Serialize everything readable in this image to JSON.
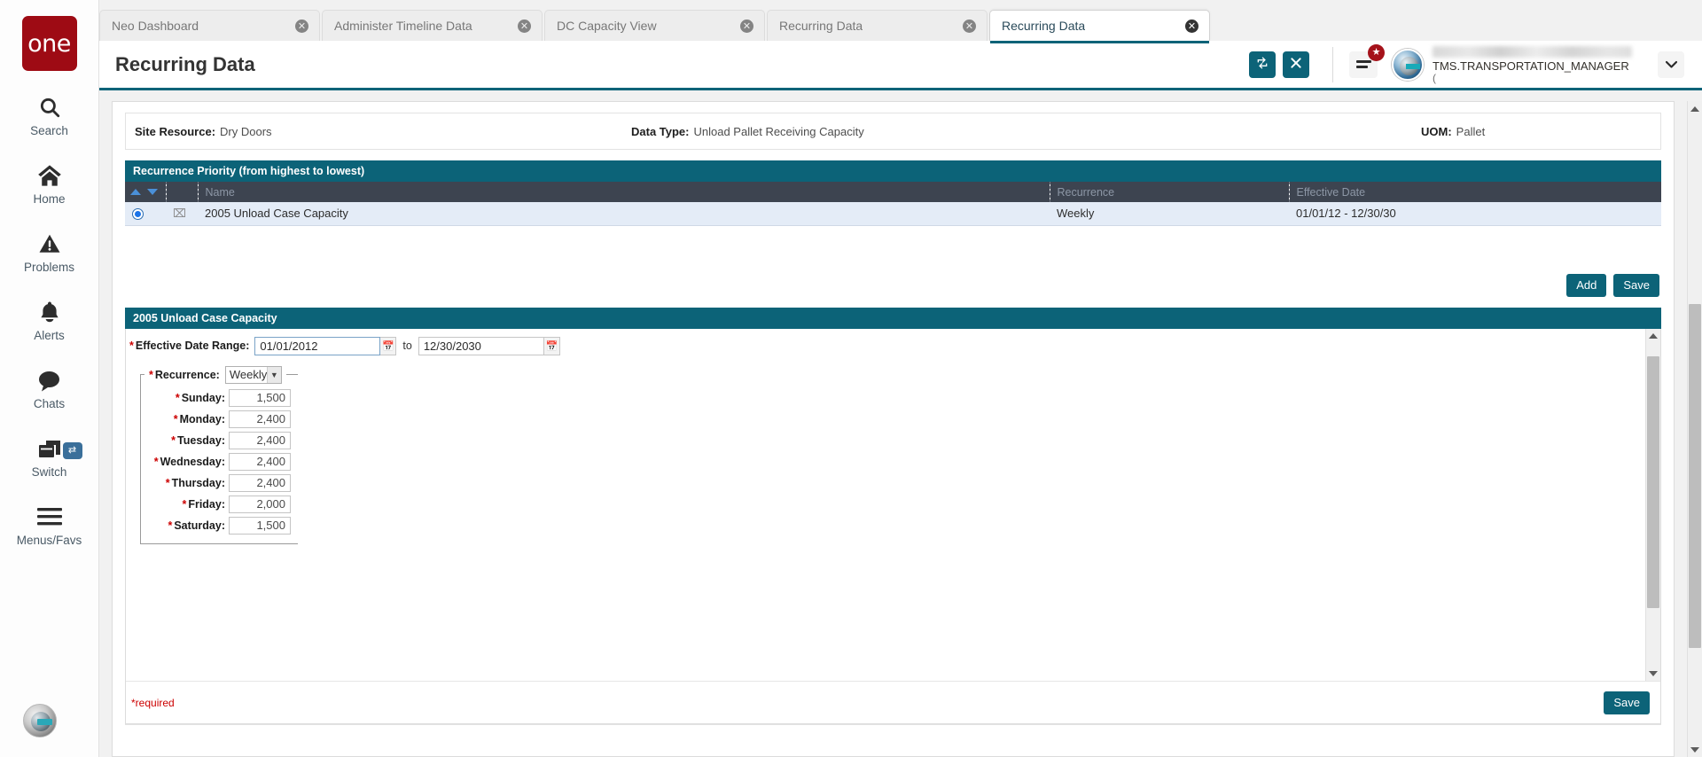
{
  "app": {
    "logo_text": "one"
  },
  "sidebar": {
    "items": [
      {
        "label": "Search",
        "icon": "search-icon"
      },
      {
        "label": "Home",
        "icon": "home-icon"
      },
      {
        "label": "Problems",
        "icon": "warning-triangle-icon"
      },
      {
        "label": "Alerts",
        "icon": "bell-icon"
      },
      {
        "label": "Chats",
        "icon": "chat-bubble-icon"
      },
      {
        "label": "Switch",
        "icon": "windows-stack-icon",
        "badge": "⇄"
      },
      {
        "label": "Menus/Favs",
        "icon": "hamburger-icon"
      }
    ]
  },
  "tabs": [
    {
      "label": "Neo Dashboard",
      "active": false
    },
    {
      "label": "Administer Timeline Data",
      "active": false
    },
    {
      "label": "DC Capacity View",
      "active": false
    },
    {
      "label": "Recurring Data",
      "active": false
    },
    {
      "label": "Recurring Data",
      "active": true
    }
  ],
  "header": {
    "title": "Recurring Data",
    "refresh_icon": "refresh-icon",
    "close_icon": "close-icon",
    "menu_icon": "hamburger-menu-icon",
    "badge_icon": "star-badge",
    "user_role": "TMS.TRANSPORTATION_MANAGER",
    "user_sub": "(",
    "caret_icon": "chevron-down-icon"
  },
  "info_bar": {
    "site_resource_label": "Site Resource:",
    "site_resource_value": "Dry Doors",
    "data_type_label": "Data Type:",
    "data_type_value": "Unload Pallet Receiving Capacity",
    "uom_label": "UOM:",
    "uom_value": "Pallet"
  },
  "recurrence_panel": {
    "title": "Recurrence Priority (from highest to lowest)",
    "columns": [
      "",
      "",
      "Name",
      "Recurrence",
      "Effective Date"
    ],
    "rows": [
      {
        "selected": true,
        "name": "2005 Unload Case Capacity",
        "recurrence": "Weekly",
        "effective_date": "01/01/12 - 12/30/30"
      }
    ],
    "add_label": "Add",
    "save_label": "Save"
  },
  "detail_panel": {
    "title": "2005 Unload Case Capacity",
    "effective_date_range_label": "Effective Date Range:",
    "date_from": "01/01/2012",
    "date_to": "12/30/2030",
    "to_word": "to",
    "recurrence_label": "Recurrence:",
    "recurrence_value": "Weekly",
    "recurrence_options": [
      "Weekly"
    ],
    "days": [
      {
        "label": "Sunday:",
        "value": "1,500"
      },
      {
        "label": "Monday:",
        "value": "2,400"
      },
      {
        "label": "Tuesday:",
        "value": "2,400"
      },
      {
        "label": "Wednesday:",
        "value": "2,400"
      },
      {
        "label": "Thursday:",
        "value": "2,400"
      },
      {
        "label": "Friday:",
        "value": "2,000"
      },
      {
        "label": "Saturday:",
        "value": "1,500"
      }
    ],
    "required_note": "*required",
    "save_label": "Save"
  },
  "colors": {
    "brand_red": "#9e0b14",
    "accent_teal": "#0c6378",
    "grid_header": "#3d4450",
    "row_selected": "#e4ecf7",
    "required_red": "#cc0000"
  }
}
